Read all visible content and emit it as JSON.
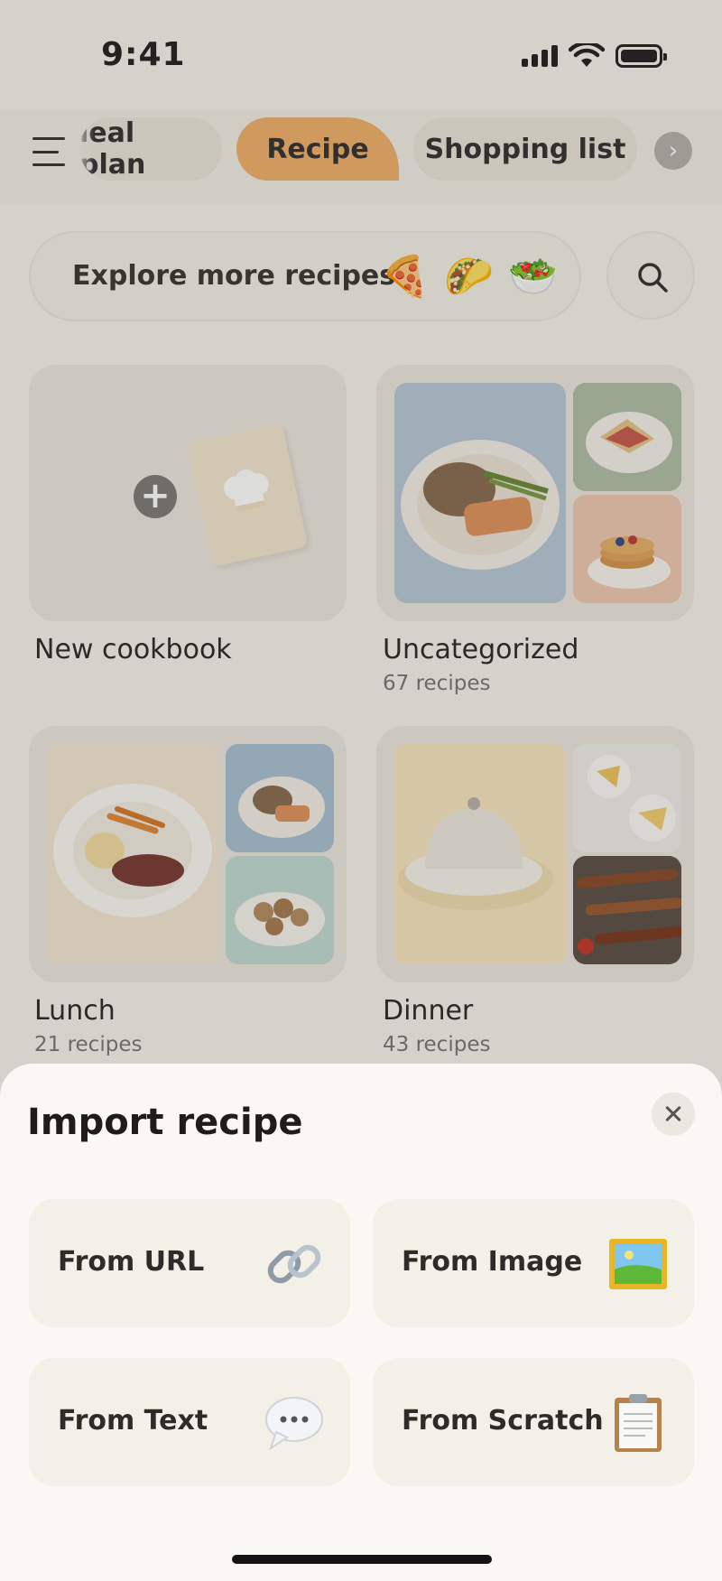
{
  "status_bar": {
    "time": "9:41"
  },
  "nav": {
    "tabs": [
      {
        "label": "Meal plan",
        "display": "leal plan"
      },
      {
        "label": "Recipe"
      },
      {
        "label": "Shopping list"
      }
    ],
    "active_tab": "Recipe",
    "accent": "#f1b06a"
  },
  "explore": {
    "label": "Explore more recipes",
    "emojis": [
      "🍕",
      "🌮",
      "🥗"
    ]
  },
  "cookbooks": [
    {
      "title": "New cookbook",
      "count": ""
    },
    {
      "title": "Uncategorized",
      "count": "67 recipes"
    },
    {
      "title": "Lunch",
      "count": "21 recipes"
    },
    {
      "title": "Dinner",
      "count": "43 recipes"
    }
  ],
  "import_sheet": {
    "title": "Import recipe",
    "options": [
      {
        "label": "From URL",
        "icon": "link-icon"
      },
      {
        "label": "From Image",
        "icon": "picture-frame-icon"
      },
      {
        "label": "From Text",
        "icon": "speech-bubble-icon"
      },
      {
        "label": "From Scratch",
        "icon": "clipboard-icon"
      }
    ]
  }
}
